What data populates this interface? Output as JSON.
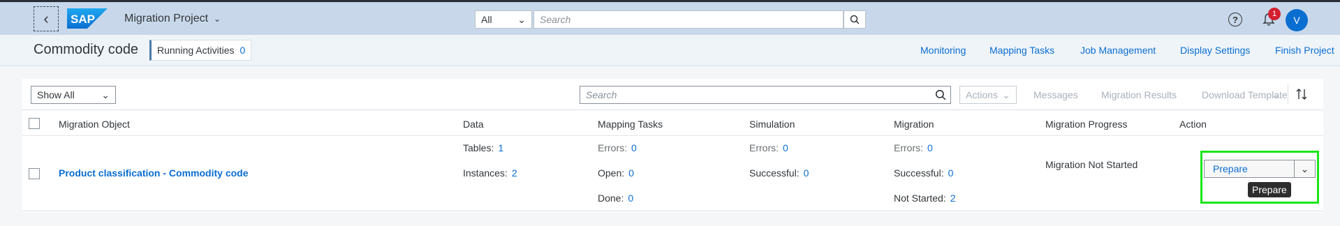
{
  "shell": {
    "logo_text": "SAP",
    "app_title": "Migration Project",
    "search_scope": "All",
    "search_placeholder": "Search",
    "notification_count": "1",
    "avatar_initial": "V"
  },
  "subheader": {
    "title": "Commodity code",
    "running_activities_label": "Running Activities",
    "running_activities_count": "0",
    "nav": [
      "Monitoring",
      "Mapping Tasks",
      "Job Management",
      "Display Settings",
      "Finish Project"
    ]
  },
  "toolbar": {
    "filter_value": "Show All",
    "search_placeholder": "Search",
    "actions_label": "Actions",
    "messages_label": "Messages",
    "migration_results_label": "Migration Results",
    "download_template_label": "Download Template"
  },
  "table": {
    "headers": {
      "object": "Migration Object",
      "data": "Data",
      "mapping": "Mapping Tasks",
      "simulation": "Simulation",
      "migration": "Migration",
      "progress": "Migration Progress",
      "action": "Action"
    },
    "row": {
      "object_name": "Product classification - Commodity code",
      "data": {
        "tables_label": "Tables:",
        "tables": "1",
        "instances_label": "Instances:",
        "instances": "2"
      },
      "mapping": {
        "errors_label": "Errors:",
        "errors": "0",
        "open_label": "Open:",
        "open": "0",
        "done_label": "Done:",
        "done": "0"
      },
      "simulation": {
        "errors_label": "Errors:",
        "errors": "0",
        "successful_label": "Successful:",
        "successful": "0"
      },
      "migration": {
        "errors_label": "Errors:",
        "errors": "0",
        "successful_label": "Successful:",
        "successful": "0",
        "not_started_label": "Not Started:",
        "not_started": "2"
      },
      "progress": "Migration Not Started",
      "action_label": "Prepare",
      "tooltip": "Prepare"
    }
  },
  "colors": {
    "shell_bg": "#c8d8ea",
    "link": "#0a6ed1",
    "highlight": "#19e619"
  }
}
